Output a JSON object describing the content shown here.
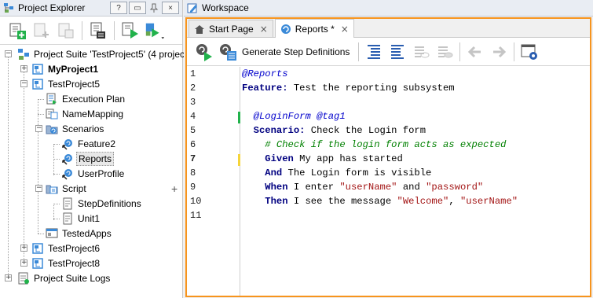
{
  "explorer": {
    "title": "Project Explorer",
    "title_buttons": [
      "?",
      "▭",
      "×"
    ],
    "tree": [
      {
        "label": "Project Suite 'TestProject5' (4 projects)",
        "bold": false
      },
      {
        "label": "MyProject1",
        "bold": true
      },
      {
        "label": "TestProject5",
        "bold": false
      },
      {
        "label": "Execution Plan",
        "bold": false
      },
      {
        "label": "NameMapping",
        "bold": false
      },
      {
        "label": "Scenarios",
        "bold": false
      },
      {
        "label": "Feature2",
        "bold": false
      },
      {
        "label": "Reports",
        "bold": false,
        "selected": true
      },
      {
        "label": "UserProfile",
        "bold": false
      },
      {
        "label": "Script",
        "bold": false
      },
      {
        "label": "StepDefinitions",
        "bold": false
      },
      {
        "label": "Unit1",
        "bold": false
      },
      {
        "label": "TestedApps",
        "bold": false
      },
      {
        "label": "TestProject6",
        "bold": false
      },
      {
        "label": "TestProject8",
        "bold": false
      },
      {
        "label": "Project Suite Logs",
        "bold": false
      }
    ],
    "add_glyph": "+"
  },
  "workspace": {
    "title": "Workspace",
    "tabs": [
      {
        "label": "Start Page",
        "icon": "home-icon"
      },
      {
        "label": "Reports *",
        "icon": "bdd-feature-icon",
        "active": true
      }
    ],
    "generate_label": "Generate Step Definitions"
  },
  "editor": {
    "line_numbers": [
      "1",
      "2",
      "3",
      "4",
      "5",
      "6",
      "7",
      "8",
      "9",
      "10",
      "11"
    ],
    "current_line": 7,
    "lines": [
      [
        {
          "t": "tag",
          "v": "@Reports"
        }
      ],
      [
        {
          "t": "kw",
          "v": "Feature:"
        },
        {
          "t": "txt",
          "v": " Test the reporting subsystem"
        }
      ],
      [],
      [
        {
          "t": "txt",
          "v": "  "
        },
        {
          "t": "tag",
          "v": "@LoginForm @tag1"
        }
      ],
      [
        {
          "t": "txt",
          "v": "  "
        },
        {
          "t": "kw",
          "v": "Scenario:"
        },
        {
          "t": "txt",
          "v": " Check the Login form"
        }
      ],
      [
        {
          "t": "txt",
          "v": "    "
        },
        {
          "t": "cm",
          "v": "# Check if the login form acts as expected"
        }
      ],
      [
        {
          "t": "txt",
          "v": "    "
        },
        {
          "t": "kw",
          "v": "Given"
        },
        {
          "t": "txt",
          "v": " My app has started"
        }
      ],
      [
        {
          "t": "txt",
          "v": "    "
        },
        {
          "t": "kw",
          "v": "And"
        },
        {
          "t": "txt",
          "v": " The Login form is visible"
        }
      ],
      [
        {
          "t": "txt",
          "v": "    "
        },
        {
          "t": "kw",
          "v": "When"
        },
        {
          "t": "txt",
          "v": " I enter "
        },
        {
          "t": "str",
          "v": "\"userName\""
        },
        {
          "t": "txt",
          "v": " and "
        },
        {
          "t": "str",
          "v": "\"password\""
        }
      ],
      [
        {
          "t": "txt",
          "v": "    "
        },
        {
          "t": "kw",
          "v": "Then"
        },
        {
          "t": "txt",
          "v": " I see the message "
        },
        {
          "t": "str",
          "v": "\"Welcome\""
        },
        {
          "t": "txt",
          "v": ", "
        },
        {
          "t": "str",
          "v": "\"userName\""
        }
      ],
      []
    ]
  },
  "colors": {
    "accent": "#f7941d",
    "change_green": "#21b24b",
    "change_yellow": "#f5d43a"
  }
}
